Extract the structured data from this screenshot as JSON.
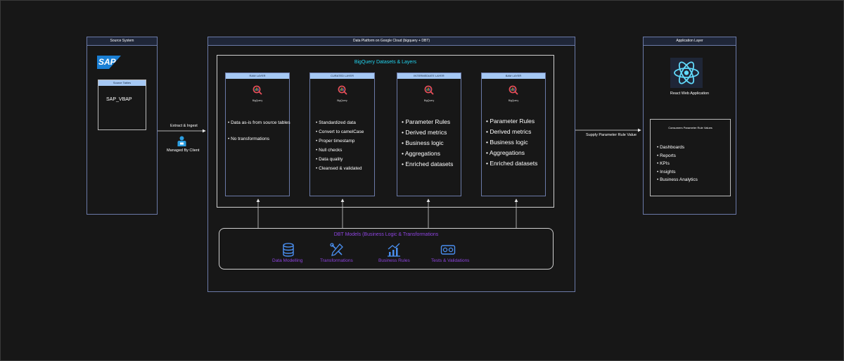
{
  "source": {
    "title": "Source System",
    "logo_text": "SAP",
    "tables_title": "Source Tables",
    "table_name": "SAP_VBAP"
  },
  "flow_left": {
    "arrow_label": "Extract & Ingest",
    "actor_label": "Managed By Client",
    "actor_icon": "user-icon"
  },
  "platform": {
    "title": "Data Platform on Google Cloud (bigquery + DBT)",
    "datasets_title": "BigQuery Datasets & Layers",
    "layers": [
      {
        "title": "RAW LAYER",
        "logo": "BigQuery",
        "items": [
          "Data as-is from source tables",
          "No transformations"
        ]
      },
      {
        "title": "CURATED LAYER",
        "logo": "BigQuery",
        "items": [
          "Standardized data",
          "Convert to camelCase",
          "Proper timestamp",
          "Null checks",
          "Data quality",
          "Cleansed & validated"
        ]
      },
      {
        "title": "INTERMEDIATE LAYER",
        "logo": "BigQuery",
        "items": [
          "Parameter Rules",
          "Derived metrics",
          "Business logic",
          "Aggregations",
          "Enriched datasets"
        ]
      },
      {
        "title": "BAM LAYER",
        "logo": "BigQuery",
        "items": [
          "Parameter Rules",
          "Derived metrics",
          "Business logic",
          "Aggregations",
          "Enriched datasets"
        ]
      }
    ],
    "dbt": {
      "title": "DBT Models (Business Logic & Transformations",
      "items": [
        {
          "label": "Data Modelling",
          "icon": "database-icon"
        },
        {
          "label": "Transformations",
          "icon": "tools-icon"
        },
        {
          "label": "Business Rules",
          "icon": "chart-icon"
        },
        {
          "label": "Tests & Validations",
          "icon": "vr-icon"
        }
      ]
    }
  },
  "flow_right": {
    "arrow_label": "Supply Parameter Rule Value"
  },
  "app": {
    "title": "Application Layer",
    "logo": "react-icon",
    "app_name": "React Web Application",
    "consumers_title": "Consumers Parameter Rule Values",
    "consumers": [
      "Dashboards",
      "Reports",
      "KPIs",
      "Insights",
      "Business Analytics"
    ]
  },
  "colors": {
    "background": "#171717",
    "border": "#6b7aa8",
    "layer_header": "#a5c8f4",
    "accent_cyan": "#22d3ee",
    "dbt_purple": "#8e44e0",
    "sap_blue": "#1a7fd4",
    "react_bg": "#1f2637",
    "react_cyan": "#61dafb"
  }
}
